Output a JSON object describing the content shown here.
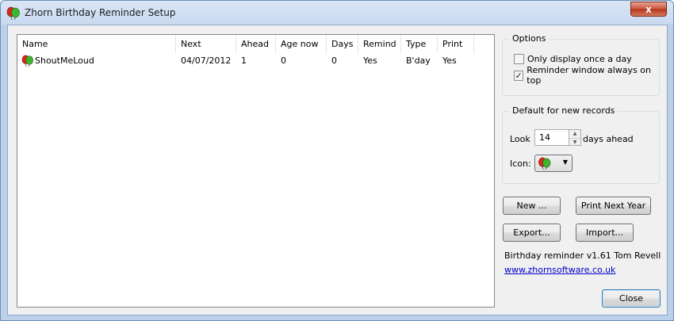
{
  "window": {
    "title": "Zhorn Birthday Reminder Setup",
    "close_glyph": "x"
  },
  "list": {
    "columns": [
      "Name",
      "Next",
      "Ahead",
      "Age now",
      "Days",
      "Remind",
      "Type",
      "Print"
    ],
    "rows": [
      {
        "name": "ShoutMeLoud",
        "next": "04/07/2012",
        "ahead": "1",
        "age_now": "0",
        "days": "0",
        "remind": "Yes",
        "type": "B'day",
        "print": "Yes",
        "icon": "balloons-icon"
      }
    ]
  },
  "options": {
    "title": "Options",
    "once_a_day": {
      "label": "Only display once a day",
      "checked": false
    },
    "always_on_top": {
      "label": "Reminder window always on top",
      "checked": true
    }
  },
  "defaults": {
    "title": "Default for new records",
    "look_label": "Look",
    "days_value": "14",
    "days_suffix": "days ahead",
    "icon_label": "Icon:",
    "icon_name": "balloons-icon"
  },
  "buttons": {
    "new": "New ...",
    "print_next_year": "Print Next Year",
    "export": "Export...",
    "import": "Import...",
    "close": "Close"
  },
  "about": {
    "version": "Birthday reminder v1.61 Tom Revell",
    "url": "www.zhornsoftware.co.uk"
  },
  "colors": {
    "balloon_red": "#d42a1f",
    "balloon_green": "#3db52e",
    "link": "#0000cc"
  }
}
